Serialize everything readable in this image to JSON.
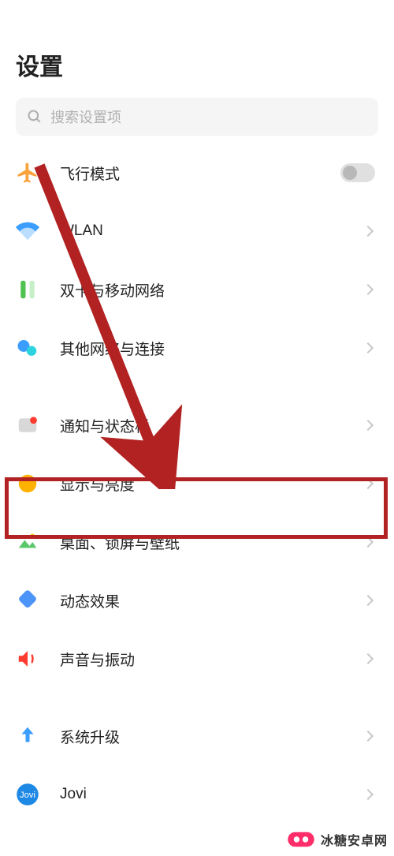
{
  "page_title": "设置",
  "search": {
    "placeholder": "搜索设置项"
  },
  "rows": {
    "airplane": {
      "label": "飞行模式"
    },
    "wlan": {
      "label": "WLAN"
    },
    "sim": {
      "label": "双卡与移动网络"
    },
    "other_net": {
      "label": "其他网络与连接"
    },
    "notif": {
      "label": "通知与状态栏"
    },
    "display": {
      "label": "显示与亮度"
    },
    "wallpaper": {
      "label": "桌面、锁屏与壁纸"
    },
    "effects": {
      "label": "动态效果"
    },
    "sound": {
      "label": "声音与振动"
    },
    "update": {
      "label": "系统升级"
    },
    "jovi": {
      "label": "Jovi"
    }
  },
  "watermark": "冰糖安卓网"
}
